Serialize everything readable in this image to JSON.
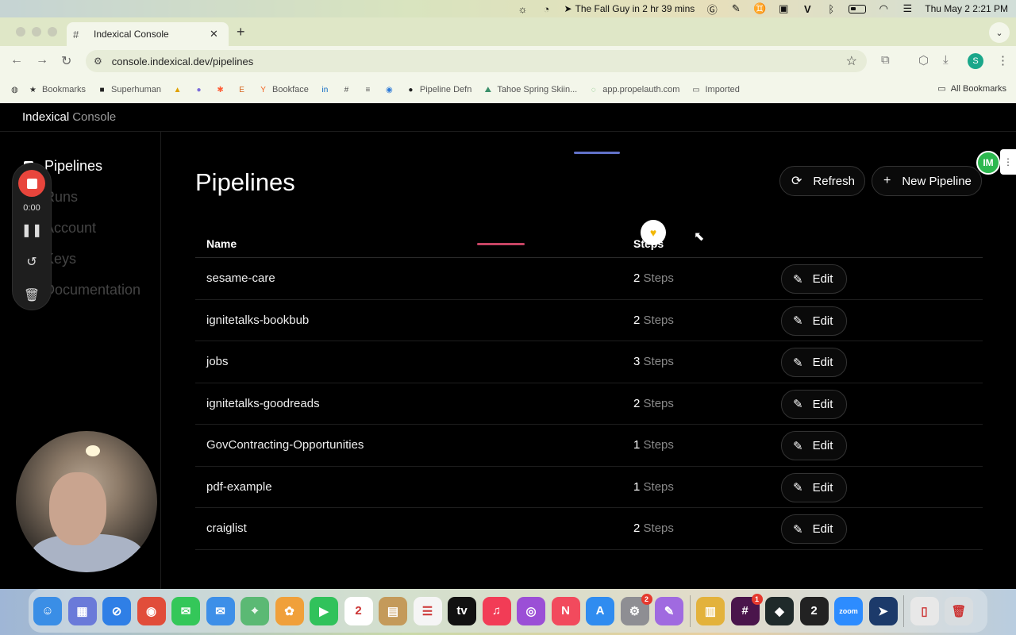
{
  "menubar": {
    "apple_icon": "apple-logo",
    "now_playing": "The Fall Guy in 2 hr 39 mins",
    "datetime": "Thu May 2  2:21 PM"
  },
  "browser": {
    "tab_title": "Indexical Console",
    "url": "console.indexical.dev/pipelines",
    "profile_initial": "S",
    "bookmarks": [
      {
        "label": "Bookmarks",
        "icon": "star-icon",
        "color": "#333333"
      },
      {
        "label": "Superhuman",
        "icon": "superhuman-icon",
        "color": "#222222"
      },
      {
        "label": "",
        "icon": "triangle-icon",
        "color": "#e0a100"
      },
      {
        "label": "",
        "icon": "orb-icon",
        "color": "#7b6cd9"
      },
      {
        "label": "",
        "icon": "hubspot-icon",
        "color": "#ff5c35"
      },
      {
        "label": "",
        "icon": "etsy-icon",
        "color": "#d5641c"
      },
      {
        "label": "Bookface",
        "icon": "yc-icon",
        "color": "#f26522"
      },
      {
        "label": "",
        "icon": "linkedin-icon",
        "color": "#0a66c2"
      },
      {
        "label": "",
        "icon": "hash-icon",
        "color": "#555555"
      },
      {
        "label": "",
        "icon": "bars-icon",
        "color": "#555555"
      },
      {
        "label": "",
        "icon": "play-circle-icon",
        "color": "#2f7bd8"
      },
      {
        "label": "Pipeline Defn",
        "icon": "github-icon",
        "color": "#222222"
      },
      {
        "label": "Tahoe Spring Skiin...",
        "icon": "ski-icon",
        "color": "#3a8f6a"
      },
      {
        "label": "app.propelauth.com",
        "icon": "globe-icon",
        "color": "#66bb6a"
      },
      {
        "label": "Imported",
        "icon": "folder-icon",
        "color": "#555555"
      }
    ],
    "all_bookmarks": "All Bookmarks"
  },
  "app": {
    "brand": "Indexical",
    "brand_suffix": "Console",
    "sidebar": [
      {
        "label": "Pipelines",
        "active": true
      },
      {
        "label": "Runs",
        "active": false
      },
      {
        "label": "Account",
        "active": false
      },
      {
        "label": "Keys",
        "active": false
      },
      {
        "label": "Documentation",
        "active": false
      }
    ],
    "page_title": "Pipelines",
    "refresh_label": "Refresh",
    "new_pipeline_label": "New Pipeline",
    "table": {
      "columns": [
        "Name",
        "Steps"
      ],
      "edit_label": "Edit",
      "steps_word": "Steps",
      "rows": [
        {
          "name": "sesame-care",
          "steps": "2"
        },
        {
          "name": "ignitetalks-bookbub",
          "steps": "2"
        },
        {
          "name": "jobs",
          "steps": "3"
        },
        {
          "name": "ignitetalks-goodreads",
          "steps": "2"
        },
        {
          "name": "GovContracting-Opportunities",
          "steps": "1"
        },
        {
          "name": "pdf-example",
          "steps": "1"
        },
        {
          "name": "craiglist",
          "steps": "2"
        }
      ]
    }
  },
  "recorder": {
    "time": "0:00"
  },
  "overlay": {
    "im_badge": "IM"
  },
  "dock": {
    "apps": [
      {
        "name": "finder",
        "color": "#3a8ee6",
        "glyph": "☺"
      },
      {
        "name": "launchpad",
        "color": "#6a7ad9",
        "glyph": "▦"
      },
      {
        "name": "safari",
        "color": "#2f7fe6",
        "glyph": "⊘"
      },
      {
        "name": "chrome",
        "color": "#e14d3a",
        "glyph": "◉"
      },
      {
        "name": "messages",
        "color": "#34c759",
        "glyph": "✉"
      },
      {
        "name": "mail",
        "color": "#3d8fe8",
        "glyph": "✉"
      },
      {
        "name": "maps",
        "color": "#5bb974",
        "glyph": "⌖"
      },
      {
        "name": "photos",
        "color": "#f0a03a",
        "glyph": "✿"
      },
      {
        "name": "facetime",
        "color": "#31c25b",
        "glyph": "▶"
      },
      {
        "name": "calendar",
        "color": "#ffffff",
        "glyph": "2"
      },
      {
        "name": "notes-app",
        "color": "#c49a5a",
        "glyph": "▤"
      },
      {
        "name": "reminders",
        "color": "#f5f5f5",
        "glyph": "☰"
      },
      {
        "name": "apple-tv",
        "color": "#111111",
        "glyph": "tv"
      },
      {
        "name": "music",
        "color": "#f23c56",
        "glyph": "♫"
      },
      {
        "name": "podcasts",
        "color": "#9b4fd6",
        "glyph": "◎"
      },
      {
        "name": "news",
        "color": "#f24a5d",
        "glyph": "N"
      },
      {
        "name": "app-store",
        "color": "#2f8cf0",
        "glyph": "A"
      },
      {
        "name": "system-settings",
        "color": "#8e8e93",
        "glyph": "⚙",
        "badge": "2"
      },
      {
        "name": "pen-app",
        "color": "#a06ae0",
        "glyph": "✎"
      },
      {
        "name": "sep",
        "color": "",
        "glyph": ""
      },
      {
        "name": "stacks",
        "color": "#e3b23c",
        "glyph": "▥"
      },
      {
        "name": "slack",
        "color": "#4a154b",
        "glyph": "#",
        "badge": "1"
      },
      {
        "name": "notion-like",
        "color": "#1f2a2a",
        "glyph": "◆"
      },
      {
        "name": "two-app",
        "color": "#222222",
        "glyph": "2"
      },
      {
        "name": "zoom",
        "color": "#2d8cff",
        "glyph": "zoom"
      },
      {
        "name": "send-app",
        "color": "#1c3a6a",
        "glyph": "➤"
      },
      {
        "name": "sep",
        "color": "",
        "glyph": ""
      },
      {
        "name": "documents",
        "color": "#e8e8e8",
        "glyph": "▯"
      },
      {
        "name": "trash",
        "color": "#d8dde0",
        "glyph": "🗑"
      }
    ]
  }
}
